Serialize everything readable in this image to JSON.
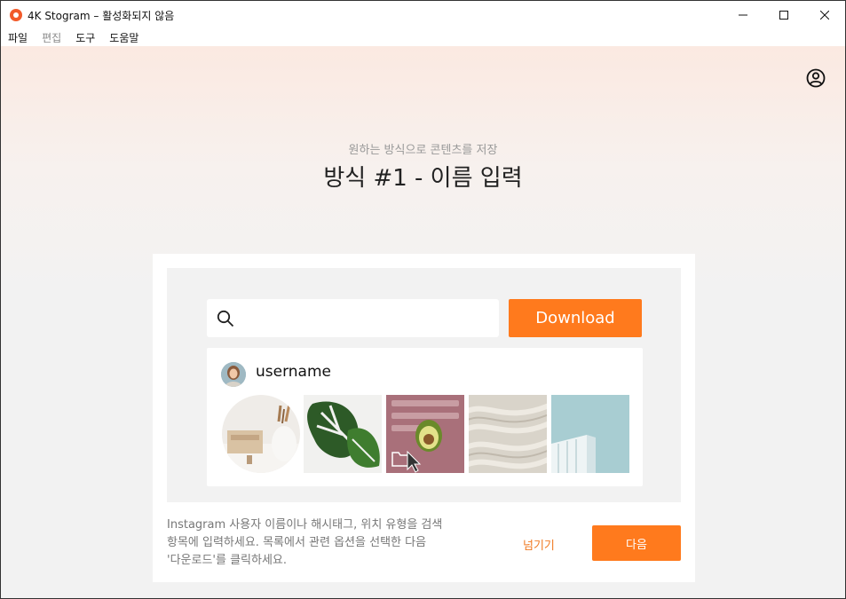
{
  "window": {
    "title": "4K Stogram – 활성화되지 않음",
    "controls": [
      "minimize-icon",
      "maximize-icon",
      "close-icon"
    ]
  },
  "menu": {
    "items": [
      {
        "label": "파일",
        "enabled": true
      },
      {
        "label": "편집",
        "enabled": false
      },
      {
        "label": "도구",
        "enabled": true
      },
      {
        "label": "도움말",
        "enabled": true
      }
    ]
  },
  "header": {
    "subtitle": "원하는 방식으로 콘텐츠를 저장",
    "title": "방식 #1 - 이름 입력",
    "account_icon": "user-circle-icon"
  },
  "demo": {
    "search_icon": "search-icon",
    "download_label": "Download",
    "username": "username",
    "thumbnails": [
      "kitchen-utensils-image",
      "monstera-leaf-image",
      "avocado-folder-image",
      "sand-waves-image",
      "building-sky-image"
    ]
  },
  "footer": {
    "description_lines": [
      "Instagram 사용자 이름이나 해시태그, 위치 유형을 검색",
      "항목에 입력하세요. 목록에서 관련 옵션을 선택한 다음",
      "'다운로드'를 클릭하세요."
    ],
    "skip_label": "넘기기",
    "next_label": "다음"
  },
  "colors": {
    "accent": "#ff7a1d",
    "skip_text": "#f07a22",
    "background_top": "#fbe9e1",
    "background": "#f2f2f2"
  }
}
